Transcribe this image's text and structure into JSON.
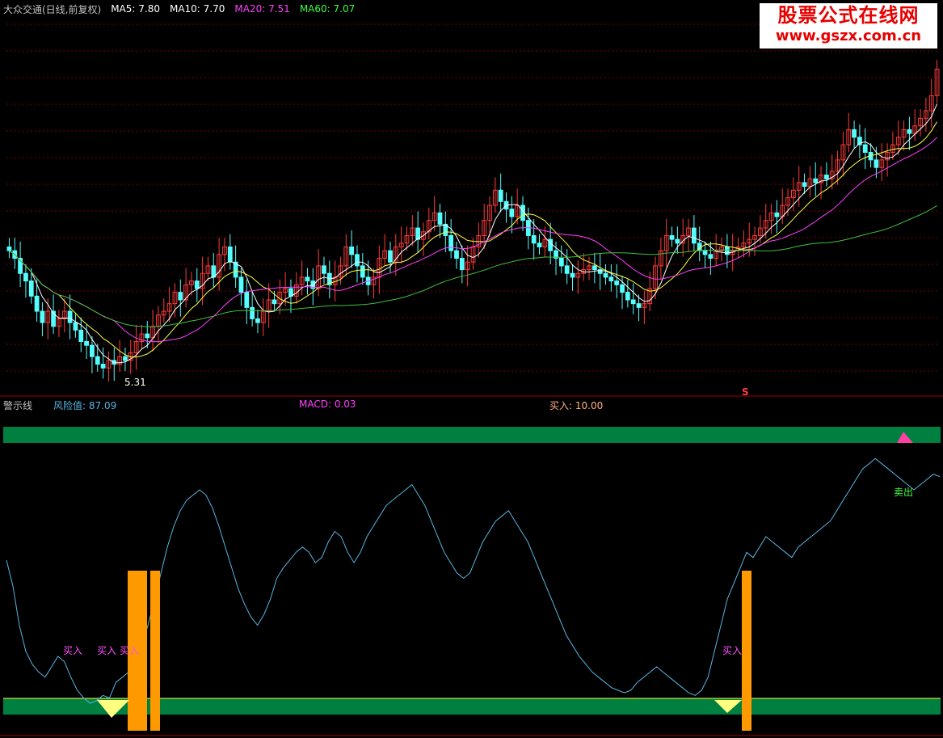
{
  "colors": {
    "background": "#000000",
    "grid": "#800000",
    "candle_up": "#ff3c3c",
    "candle_down": "#54ffff",
    "ma5": "#ffffff",
    "ma10": "#ffff40",
    "ma20": "#ff40ff",
    "ma60": "#40c040",
    "risk_line": "#5ab4e0",
    "band": "#008040",
    "buy_bar": "#ff9900",
    "buy_text": "#ff50ff",
    "sell_text": "#40ff40"
  },
  "main_panel": {
    "title": "大众交通(日线,前复权)",
    "ma_labels": [
      {
        "text": "MA5: 7.80",
        "color": "#ffffff"
      },
      {
        "text": "MA10: 7.70",
        "color": "#ffffff"
      },
      {
        "text": "MA20: 7.51",
        "color": "#ff40ff"
      },
      {
        "text": "MA60: 7.07",
        "color": "#40ff40"
      }
    ],
    "low_label": "5.31",
    "s_marker": "S"
  },
  "lower_panel": {
    "title": "警示线",
    "risk_label": "风险值: 87.09",
    "macd_label": "MACD: 0.03",
    "buy_label": "买入: 10.00",
    "buy_markers": [
      "买入",
      "买入",
      "买入",
      "买入"
    ],
    "sell_marker": "卖出"
  },
  "watermark": {
    "line1": "股票公式在线网",
    "line2": "www.gszx.com.cn"
  },
  "chart_data": [
    {
      "type": "candlestick",
      "title": "",
      "x": [
        1,
        2,
        3,
        4,
        5,
        6,
        7,
        8,
        9,
        10,
        11,
        12,
        13,
        14,
        15,
        16,
        17,
        18,
        19,
        20,
        21,
        22,
        23,
        24,
        25,
        26,
        27,
        28,
        29,
        30,
        31,
        32,
        33,
        34,
        35,
        36,
        37,
        38,
        39,
        40,
        41,
        42,
        43,
        44,
        45,
        46,
        47,
        48,
        49,
        50,
        51,
        52,
        53,
        54,
        55,
        56,
        57,
        58,
        59,
        60,
        61,
        62,
        63,
        64,
        65,
        66,
        67,
        68,
        69,
        70,
        71,
        72,
        73,
        74,
        75,
        76,
        77,
        78,
        79,
        80,
        81,
        82,
        83,
        84,
        85,
        86,
        87,
        88,
        89,
        90,
        91,
        92,
        93,
        94,
        95,
        96,
        97,
        98,
        99,
        100,
        101,
        102,
        103,
        104,
        105,
        106,
        107,
        108,
        109,
        110,
        111,
        112,
        113,
        114,
        115,
        116,
        117,
        118,
        119,
        120,
        121,
        122,
        123,
        124,
        125,
        126,
        127,
        128,
        129,
        130,
        131,
        132,
        133,
        134,
        135,
        136,
        137,
        138,
        139,
        140,
        141,
        142,
        143,
        144,
        145,
        146,
        147,
        148,
        149,
        150,
        151,
        152,
        153,
        154,
        155,
        156,
        157,
        158,
        159,
        160,
        161,
        162,
        163,
        164,
        165,
        166,
        167,
        168
      ],
      "close": [
        6.9,
        6.8,
        6.6,
        6.5,
        6.3,
        6.1,
        5.95,
        6.1,
        5.9,
        6.0,
        6.1,
        5.95,
        5.85,
        5.7,
        5.65,
        5.5,
        5.4,
        5.35,
        5.45,
        5.4,
        5.5,
        5.45,
        5.55,
        5.7,
        5.8,
        5.75,
        5.9,
        6.05,
        6.1,
        6.2,
        6.35,
        6.25,
        6.45,
        6.5,
        6.4,
        6.6,
        6.7,
        6.55,
        6.85,
        6.95,
        6.75,
        6.55,
        6.35,
        6.15,
        6.0,
        5.95,
        6.1,
        6.25,
        6.2,
        6.35,
        6.4,
        6.3,
        6.45,
        6.55,
        6.5,
        6.4,
        6.7,
        6.6,
        6.45,
        6.55,
        6.7,
        6.95,
        6.85,
        6.7,
        6.55,
        6.45,
        6.55,
        6.8,
        6.9,
        6.75,
        6.95,
        7.0,
        7.1,
        7.2,
        7.05,
        7.15,
        7.3,
        7.4,
        7.25,
        7.1,
        6.9,
        6.8,
        6.65,
        6.75,
        6.95,
        7.1,
        7.3,
        7.5,
        7.7,
        7.55,
        7.45,
        7.35,
        7.5,
        7.3,
        7.1,
        7.0,
        6.95,
        7.05,
        6.9,
        6.8,
        6.7,
        6.6,
        6.55,
        6.6,
        6.65,
        6.7,
        6.65,
        6.6,
        6.55,
        6.5,
        6.45,
        6.35,
        6.25,
        6.2,
        6.15,
        6.2,
        6.4,
        6.7,
        6.9,
        7.1,
        7.05,
        7.0,
        7.1,
        7.2,
        7.0,
        6.9,
        6.85,
        6.8,
        6.9,
        6.95,
        6.85,
        6.9,
        6.95,
        7.0,
        7.05,
        7.1,
        7.2,
        7.3,
        7.4,
        7.35,
        7.5,
        7.6,
        7.7,
        7.8,
        7.75,
        7.85,
        7.8,
        7.9,
        7.85,
        7.95,
        8.1,
        8.3,
        8.5,
        8.4,
        8.3,
        8.2,
        8.1,
        8.0,
        8.1,
        8.2,
        8.3,
        8.4,
        8.5,
        8.45,
        8.55,
        8.65,
        8.75,
        8.95,
        9.3
      ],
      "ma_series": [
        "MA5",
        "MA10",
        "MA20",
        "MA60"
      ],
      "low_point": 5.31,
      "ylim": [
        5.0,
        10.0
      ]
    },
    {
      "type": "line",
      "title": "",
      "series": [
        {
          "name": "风险值",
          "values": [
            55,
            45,
            30,
            20,
            15,
            12,
            10,
            14,
            18,
            16,
            10,
            5,
            2,
            0,
            1,
            3,
            2,
            8,
            10,
            12,
            16,
            22,
            30,
            40,
            50,
            60,
            68,
            74,
            78,
            80,
            82,
            80,
            75,
            68,
            60,
            52,
            44,
            38,
            33,
            30,
            34,
            40,
            48,
            52,
            55,
            58,
            60,
            58,
            54,
            56,
            62,
            66,
            64,
            58,
            54,
            58,
            64,
            68,
            72,
            76,
            78,
            80,
            82,
            84,
            80,
            76,
            70,
            64,
            58,
            54,
            50,
            48,
            50,
            56,
            62,
            66,
            70,
            72,
            74,
            70,
            66,
            62,
            56,
            50,
            44,
            38,
            32,
            26,
            22,
            18,
            15,
            12,
            10,
            8,
            6,
            5,
            4,
            5,
            8,
            10,
            12,
            14,
            12,
            10,
            8,
            6,
            4,
            3,
            5,
            10,
            20,
            30,
            40,
            46,
            52,
            58,
            56,
            60,
            64,
            62,
            60,
            58,
            56,
            60,
            62,
            64,
            66,
            68,
            70,
            74,
            78,
            82,
            86,
            90,
            92,
            94,
            92,
            90,
            88,
            86,
            84,
            82,
            84,
            86,
            88,
            87.09
          ]
        }
      ],
      "ylim": [
        0,
        100
      ]
    }
  ]
}
